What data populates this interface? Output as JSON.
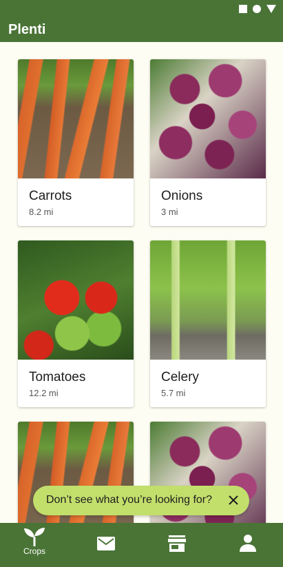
{
  "app": {
    "title": "Plenti"
  },
  "crops": [
    {
      "name": "Carrots",
      "distance": "8.2 mi",
      "image": "carrots"
    },
    {
      "name": "Onions",
      "distance": "3 mi",
      "image": "onions"
    },
    {
      "name": "Tomatoes",
      "distance": "12.2 mi",
      "image": "tomatoes"
    },
    {
      "name": "Celery",
      "distance": "5.7 mi",
      "image": "celery"
    }
  ],
  "snackbar": {
    "text": "Don’t see what you’re looking for?"
  },
  "nav": {
    "items": [
      {
        "label": "Crops",
        "icon": "sprout-icon"
      },
      {
        "icon": "mail-icon"
      },
      {
        "icon": "store-icon"
      },
      {
        "icon": "person-icon"
      }
    ]
  },
  "colors": {
    "primary": "#4a7436",
    "accent": "#c2df6c",
    "background": "#fdfdf3"
  }
}
